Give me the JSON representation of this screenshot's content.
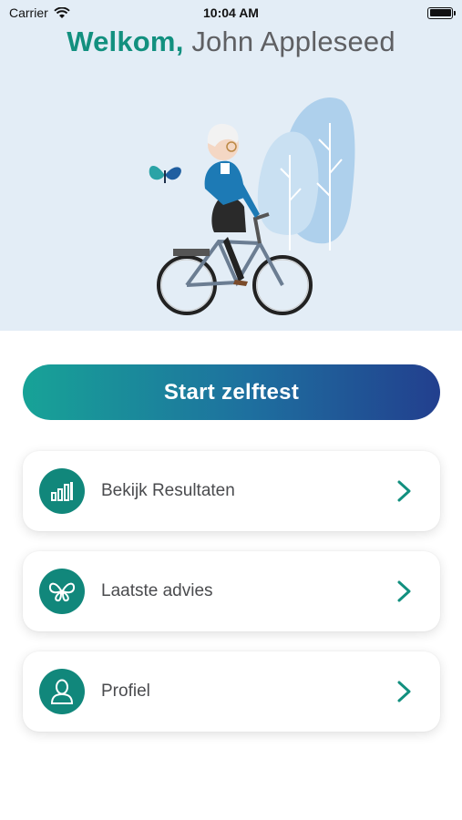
{
  "status_bar": {
    "carrier": "Carrier",
    "time": "10:04 AM",
    "icons": [
      "wifi-icon",
      "battery-icon"
    ]
  },
  "header": {
    "welcome_word": "Welkom,",
    "user_name": "John Appleseed"
  },
  "illustration": {
    "description_icons": [
      "elderly-cyclist-illustration",
      "butterfly-icon",
      "tree-icon"
    ]
  },
  "actions": {
    "start_label": "Start zelftest"
  },
  "menu": {
    "items": [
      {
        "label": "Bekijk Resultaten",
        "icon": "bar-chart-icon"
      },
      {
        "label": "Laatste advies",
        "icon": "butterfly-icon"
      },
      {
        "label": "Profiel",
        "icon": "person-icon"
      }
    ]
  },
  "colors": {
    "brand_teal": "#12907f",
    "icon_circle": "#11877b",
    "gradient_start": "#17a397",
    "gradient_end": "#223f8e",
    "hero_bg": "#e3edf6"
  }
}
